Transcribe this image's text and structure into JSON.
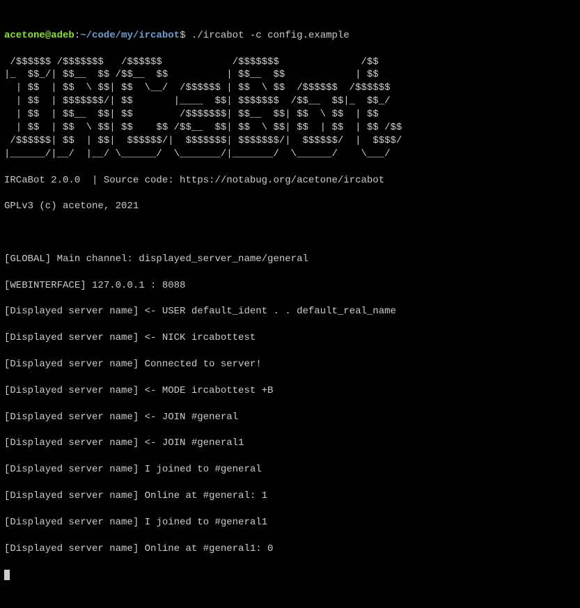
{
  "prompt": {
    "user": "acetone",
    "at": "@",
    "host": "adeb",
    "colon": ":",
    "tilde": "~",
    "path": "/code/my/ircabot",
    "dollar": "$"
  },
  "command": " ./ircabot -c config.example",
  "ascii_art": " /$$$$$$ /$$$$$$$   /$$$$$$            /$$$$$$$              /$$\n|_  $$_/| $$__  $$ /$$__  $$          | $$__  $$            | $$\n  | $$  | $$  \\ $$| $$  \\__/  /$$$$$$ | $$  \\ $$  /$$$$$$  /$$$$$$\n  | $$  | $$$$$$$/| $$       |____  $$| $$$$$$$  /$$__  $$|_  $$_/\n  | $$  | $$__  $$| $$        /$$$$$$$| $$__  $$| $$  \\ $$  | $$\n  | $$  | $$  \\ $$| $$    $$ /$$__  $$| $$  \\ $$| $$  | $$  | $$ /$$\n /$$$$$$| $$  | $$|  $$$$$$/|  $$$$$$$| $$$$$$$/|  $$$$$$/  |  $$$$/\n|______/|__/  |__/ \\______/  \\_______/|_______/  \\______/    \\___/",
  "version_line": "IRCaBot 2.0.0  | Source code: https://notabug.org/acetone/ircabot",
  "license_line": "GPLv3 (c) acetone, 2021",
  "log_lines": [
    "[GLOBAL] Main channel: displayed_server_name/general",
    "[WEBINTERFACE] 127.0.0.1 : 8088",
    "[Displayed server name] <- USER default_ident . . default_real_name",
    "[Displayed server name] <- NICK ircabottest",
    "[Displayed server name] Connected to server!",
    "[Displayed server name] <- MODE ircabottest +B",
    "[Displayed server name] <- JOIN #general",
    "[Displayed server name] <- JOIN #general1",
    "[Displayed server name] I joined to #general",
    "[Displayed server name] Online at #general: 1",
    "[Displayed server name] I joined to #general1",
    "[Displayed server name] Online at #general1: 0"
  ]
}
